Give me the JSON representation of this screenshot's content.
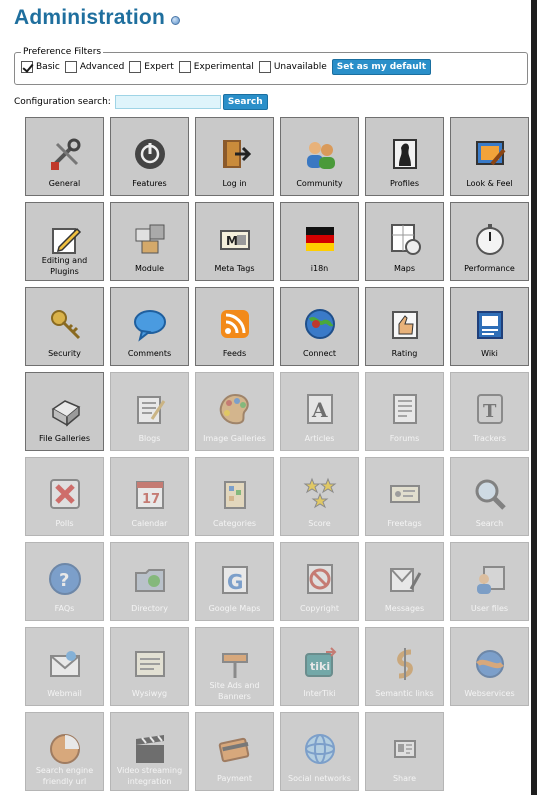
{
  "header": {
    "title": "Administration",
    "help_icon": "help-icon"
  },
  "preferences": {
    "legend": "Preference Filters",
    "options": [
      {
        "label": "Basic",
        "checked": true
      },
      {
        "label": "Advanced",
        "checked": false
      },
      {
        "label": "Expert",
        "checked": false
      },
      {
        "label": "Experimental",
        "checked": false
      },
      {
        "label": "Unavailable",
        "checked": false
      }
    ],
    "default_button": "Set as my default"
  },
  "search": {
    "label": "Configuration search:",
    "value": "",
    "button": "Search"
  },
  "colors": {
    "title": "#1f6f9e",
    "button": "#2a8fc9",
    "tile_bg": "#c6c6c6",
    "search_bg": "#dff4fb"
  },
  "tiles": [
    {
      "label": "General",
      "icon": "tools-icon",
      "active": true
    },
    {
      "label": "Features",
      "icon": "power-icon",
      "active": true
    },
    {
      "label": "Log in",
      "icon": "door-icon",
      "active": true
    },
    {
      "label": "Community",
      "icon": "people-icon",
      "active": true
    },
    {
      "label": "Profiles",
      "icon": "profile-icon",
      "active": true
    },
    {
      "label": "Look & Feel",
      "icon": "paint-icon",
      "active": true
    },
    {
      "label": "Editing and Plugins",
      "icon": "pencil-icon",
      "active": true
    },
    {
      "label": "Module",
      "icon": "module-icon",
      "active": true
    },
    {
      "label": "Meta Tags",
      "icon": "metatag-icon",
      "active": true
    },
    {
      "label": "i18n",
      "icon": "flag-icon",
      "active": true
    },
    {
      "label": "Maps",
      "icon": "map-icon",
      "active": true
    },
    {
      "label": "Performance",
      "icon": "stopwatch-icon",
      "active": true
    },
    {
      "label": "Security",
      "icon": "key-icon",
      "active": true
    },
    {
      "label": "Comments",
      "icon": "speech-bubble-icon",
      "active": true
    },
    {
      "label": "Feeds",
      "icon": "rss-icon",
      "active": true
    },
    {
      "label": "Connect",
      "icon": "globe-icon",
      "active": true
    },
    {
      "label": "Rating",
      "icon": "thumb-icon",
      "active": true
    },
    {
      "label": "Wiki",
      "icon": "wiki-icon",
      "active": true
    },
    {
      "label": "File Galleries",
      "icon": "file-drawer-icon",
      "active": true
    },
    {
      "label": "Blogs",
      "icon": "blog-icon",
      "active": false
    },
    {
      "label": "Image Galleries",
      "icon": "palette-icon",
      "active": false
    },
    {
      "label": "Articles",
      "icon": "article-icon",
      "active": false
    },
    {
      "label": "Forums",
      "icon": "forum-icon",
      "active": false
    },
    {
      "label": "Trackers",
      "icon": "tracker-icon",
      "active": false
    },
    {
      "label": "Polls",
      "icon": "poll-icon",
      "active": false
    },
    {
      "label": "Calendar",
      "icon": "calendar-icon",
      "active": false
    },
    {
      "label": "Categories",
      "icon": "categories-icon",
      "active": false
    },
    {
      "label": "Score",
      "icon": "stars-icon",
      "active": false
    },
    {
      "label": "Freetags",
      "icon": "tag-icon",
      "active": false
    },
    {
      "label": "Search",
      "icon": "magnifier-icon",
      "active": false
    },
    {
      "label": "FAQs",
      "icon": "question-icon",
      "active": false
    },
    {
      "label": "Directory",
      "icon": "directory-icon",
      "active": false
    },
    {
      "label": "Google Maps",
      "icon": "google-maps-icon",
      "active": false
    },
    {
      "label": "Copyright",
      "icon": "copyright-icon",
      "active": false
    },
    {
      "label": "Messages",
      "icon": "messages-icon",
      "active": false
    },
    {
      "label": "User files",
      "icon": "user-files-icon",
      "active": false
    },
    {
      "label": "Webmail",
      "icon": "mail-icon",
      "active": false
    },
    {
      "label": "Wysiwyg",
      "icon": "wysiwyg-icon",
      "active": false
    },
    {
      "label": "Site Ads and Banners",
      "icon": "banner-icon",
      "active": false
    },
    {
      "label": "InterTiki",
      "icon": "intertiki-icon",
      "active": false
    },
    {
      "label": "Semantic links",
      "icon": "semantic-icon",
      "active": false
    },
    {
      "label": "Webservices",
      "icon": "webservices-icon",
      "active": false
    },
    {
      "label": "Search engine friendly url",
      "icon": "sef-icon",
      "active": false
    },
    {
      "label": "Video streaming integration",
      "icon": "clapper-icon",
      "active": false
    },
    {
      "label": "Payment",
      "icon": "payment-icon",
      "active": false
    },
    {
      "label": "Social networks",
      "icon": "social-icon",
      "active": false
    },
    {
      "label": "Share",
      "icon": "share-icon",
      "active": false
    }
  ]
}
